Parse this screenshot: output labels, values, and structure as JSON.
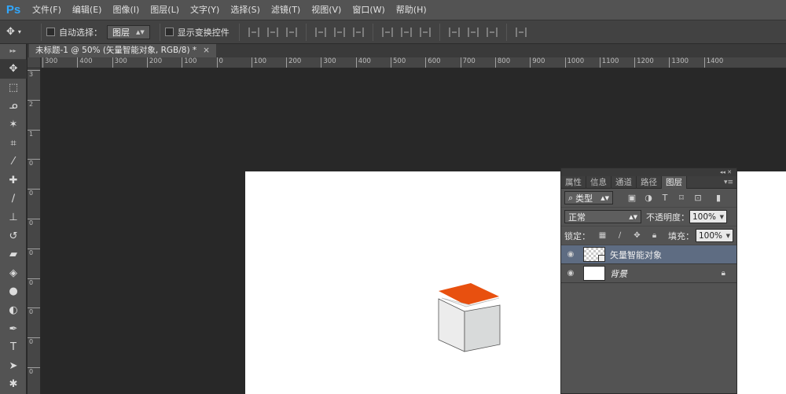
{
  "app": {
    "logo": "Ps"
  },
  "menu": [
    "文件(F)",
    "编辑(E)",
    "图像(I)",
    "图层(L)",
    "文字(Y)",
    "选择(S)",
    "滤镜(T)",
    "视图(V)",
    "窗口(W)",
    "帮助(H)"
  ],
  "options": {
    "tool_icon": "move-tool-icon",
    "auto_select_label": "自动选择：",
    "auto_select_value": "图层",
    "show_transform_label": "显示变换控件"
  },
  "document": {
    "tab_title": "未标题-1 @ 50% (矢量智能对象, RGB/8) *",
    "close": "×"
  },
  "ruler": {
    "h_labels": [
      "300",
      "400",
      "300",
      "200",
      "100",
      "0",
      "100",
      "200",
      "300",
      "400",
      "500",
      "600",
      "700",
      "800",
      "900",
      "1000",
      "1100",
      "1200",
      "1300",
      "1400"
    ],
    "v_labels": [
      "3",
      "0",
      "0",
      "2",
      "0",
      "0",
      "1",
      "0",
      "0",
      "0",
      "1",
      "0",
      "0",
      "2",
      "0",
      "0",
      "3",
      "0",
      "0",
      "4",
      "0",
      "0",
      "5",
      "0",
      "0",
      "6",
      "0",
      "0",
      "7",
      "0",
      "0",
      "8"
    ]
  },
  "tools": [
    "move-tool-icon",
    "marquee-tool-icon",
    "lasso-tool-icon",
    "magic-wand-tool-icon",
    "crop-tool-icon",
    "eyedropper-tool-icon",
    "healing-brush-tool-icon",
    "brush-tool-icon",
    "clone-stamp-tool-icon",
    "history-brush-tool-icon",
    "eraser-tool-icon",
    "paint-bucket-tool-icon",
    "blur-tool-icon",
    "dodge-tool-icon",
    "pen-tool-icon",
    "type-tool-icon",
    "path-selection-tool-icon",
    "custom-shape-tool-icon"
  ],
  "layers_panel": {
    "tabs": [
      "属性",
      "信息",
      "通道",
      "路径",
      "图层"
    ],
    "active_tab": "图层",
    "filter_label": "类型",
    "blend_mode": "正常",
    "opacity_label": "不透明度：",
    "opacity_value": "100%",
    "lock_label": "锁定：",
    "fill_label": "填充：",
    "fill_value": "100%",
    "layers": [
      {
        "name": "矢量智能对象",
        "selected": true,
        "visible": true
      },
      {
        "name": "背景",
        "selected": false,
        "visible": true,
        "locked": true
      }
    ]
  },
  "colors": {
    "accent": "#31a8ff",
    "cube_top": "#e8500f",
    "cube_side": "#d8dada",
    "selection": "#5e6c82"
  }
}
